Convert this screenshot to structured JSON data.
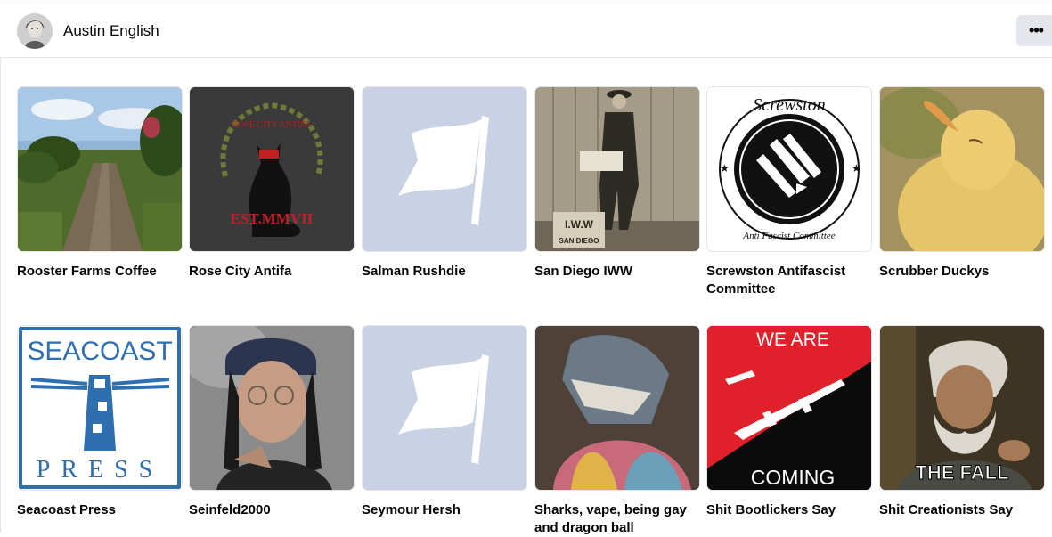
{
  "profile": {
    "name": "Austin English",
    "avatar_icon": "person-portrait-avatar",
    "more_icon": "ellipsis-icon",
    "more_label": "•••"
  },
  "pages": [
    {
      "name": "Rooster Farms Coffee",
      "thumbnail": "farm-road-photo"
    },
    {
      "name": "Rose City Antifa",
      "thumbnail": "black-cat-logo"
    },
    {
      "name": "Salman Rushdie",
      "thumbnail": "default-flag-icon"
    },
    {
      "name": "San Diego IWW",
      "thumbnail": "vintage-man-photo"
    },
    {
      "name": "Screwston Antifascist Committee",
      "thumbnail": "screws-logo"
    },
    {
      "name": "Scrubber Duckys",
      "thumbnail": "duckling-photo"
    },
    {
      "name": "Seacoast Press",
      "thumbnail": "lighthouse-logo"
    },
    {
      "name": "Seinfeld2000",
      "thumbnail": "seinfeld-meme-photo"
    },
    {
      "name": "Seymour Hersh",
      "thumbnail": "default-flag-icon"
    },
    {
      "name": "Sharks, vape, being gay and dragon ball",
      "thumbnail": "shark-hoodie-image"
    },
    {
      "name": "Shit Bootlickers Say",
      "thumbnail": "red-black-flag-image"
    },
    {
      "name": "Shit Creationists Say",
      "thumbnail": "ancient-aliens-meme"
    }
  ],
  "images_text": {
    "rose_city_ring": "ROSE CITY ANTIFA",
    "rose_city_est": "EST.MMVII",
    "iww_sign": "I.W.W",
    "iww_city": "SAN DIEGO",
    "screwston_top": "Screwston",
    "screwston_bottom": "Anti Fascist Committee",
    "seacoast_top": "SEACOAST",
    "seacoast_bottom": "PRESS",
    "bootlickers_top": "WE ARE",
    "bootlickers_bottom": "COMING",
    "creationists_caption": "THE FALL"
  }
}
